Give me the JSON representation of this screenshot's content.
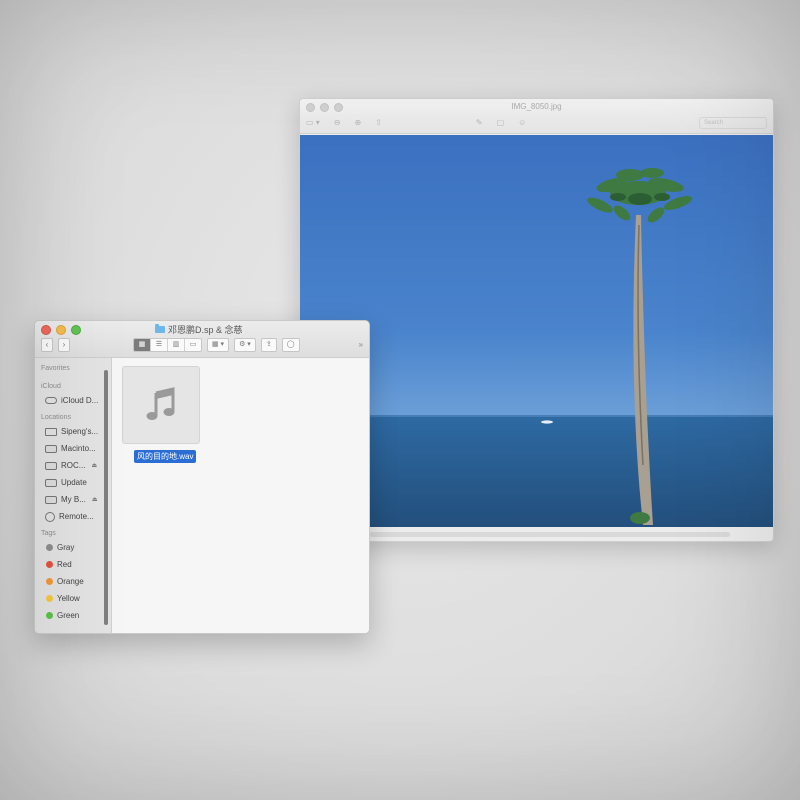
{
  "preview": {
    "title": "IMG_8050.jpg",
    "toolbar": [
      "▭ ▾",
      "⊖",
      "⊕",
      "⇧",
      "✎",
      "▢",
      "☺"
    ],
    "search_placeholder": "Search"
  },
  "finder": {
    "title": "邓恩鹏D.sp & 念慈",
    "nav": {
      "back": "‹",
      "forward": "›"
    },
    "view_buttons": [
      "▦",
      "☰",
      "▥",
      "▭"
    ],
    "group_label": "▦ ▾",
    "action_label": "⚙ ▾",
    "share_label": "⇪",
    "tag_label": "◯",
    "more_label": "»",
    "sidebar": {
      "favorites_header": "Favorites",
      "icloud_header": "iCloud",
      "icloud_items": [
        {
          "label": "iCloud D...",
          "icon": "cloud-icon"
        }
      ],
      "locations_header": "Locations",
      "location_items": [
        {
          "label": "Sipeng's...",
          "icon": "monitor-icon"
        },
        {
          "label": "Macinto...",
          "icon": "disk-icon"
        },
        {
          "label": "ROC...",
          "icon": "disk-icon",
          "eject": "⏏"
        },
        {
          "label": "Update",
          "icon": "disk-icon"
        },
        {
          "label": "My B...",
          "icon": "disk-icon",
          "eject": "⏏"
        },
        {
          "label": "Remote...",
          "icon": "globe-icon"
        }
      ],
      "tags_header": "Tags",
      "tags": [
        {
          "label": "Gray",
          "color": "#8e8e8e"
        },
        {
          "label": "Red",
          "color": "#e5533f"
        },
        {
          "label": "Orange",
          "color": "#f19a38"
        },
        {
          "label": "Yellow",
          "color": "#f5c842"
        },
        {
          "label": "Green",
          "color": "#5cc24a"
        }
      ]
    },
    "file": {
      "name": "风的目的地.wav",
      "icon": "music-note-icon"
    }
  },
  "colors": {
    "selection": "#2a6ed4",
    "sky": "#3f78c6",
    "sea": "#2a5f93"
  }
}
